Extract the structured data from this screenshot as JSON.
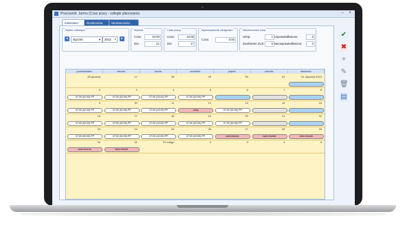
{
  "window": {
    "title": "Pracownik: Jarmu (Czas pracy - odległe planowania",
    "controls": {
      "minimize": "–",
      "close": "×"
    }
  },
  "tabs": [
    {
      "label": "Kalendarz",
      "active": true
    },
    {
      "label": "Rozliczenia",
      "active": false
    },
    {
      "label": "Nieobecności",
      "active": false
    }
  ],
  "filters": {
    "title": "Wybór miesiąca",
    "month": "styczeń",
    "year": "2013"
  },
  "summary": {
    "plan": {
      "title": "Wymiar",
      "czas_label": "Czas:",
      "czas_value": "42:00",
      "dni_label": "Dni:",
      "dni_value": "21"
    },
    "work": {
      "title": "Czas pracy",
      "czas_label": "Czas:",
      "czas_value": "34:00",
      "dni_label": "Dni:",
      "dni_value": "17"
    },
    "overtime": {
      "title": "Wykorzystanie nadgodzin",
      "czas_label": "Czas:",
      "czas_value": "0:00"
    },
    "absence": {
      "title": "Nieobecności (dni)",
      "urlop_label": "Urlop:",
      "urlop_value": "1",
      "zwolnienie_label": "Zwolnienie ZUS:",
      "zwolnienie_value": "5",
      "usprawiedliwione_label": "Usprawiedliwione:",
      "usprawiedliwione_value": "0",
      "nieusprawiedliwione_label": "Nieusprawiedliwione:",
      "nieusprawiedliwione_value": "0"
    }
  },
  "calendar": {
    "days": [
      "poniedziałek",
      "wtorek",
      "środa",
      "czwartek",
      "piątek",
      "sobota",
      "niedziela"
    ],
    "weeks": [
      {
        "nums": [
          "26 grudnia",
          "27",
          "28",
          "29",
          "30",
          "31",
          "01 stycznia 2013"
        ],
        "pills": [
          null,
          null,
          null,
          null,
          null,
          null,
          {
            "text": "",
            "kind": "blue"
          }
        ]
      },
      {
        "nums": [
          "2",
          "3",
          "4",
          "5",
          "6",
          "7",
          "8"
        ],
        "pills": [
          {
            "text": "07:00 (02:00) PP",
            "kind": "white"
          },
          {
            "text": "07:00 (02:00) PP",
            "kind": "white"
          },
          {
            "text": "07:00 (02:00) PP",
            "kind": "white"
          },
          {
            "text": "07:00 (02:00) PP",
            "kind": "white"
          },
          {
            "text": "",
            "kind": "blue"
          },
          {
            "text": "",
            "kind": "gray"
          },
          {
            "text": "",
            "kind": "blue"
          }
        ]
      },
      {
        "nums": [
          "9",
          "10",
          "11",
          "12",
          "13",
          "14",
          "15"
        ],
        "pills": [
          {
            "text": "07:00 (02:00) PP",
            "kind": "white"
          },
          {
            "text": "07:00 (02:00) PP",
            "kind": "white"
          },
          {
            "text": "07:00 (02:00) PP",
            "kind": "white"
          },
          {
            "text": "urlop",
            "kind": "pink"
          },
          {
            "text": "07:00 (02:00) PP",
            "kind": "white"
          },
          {
            "text": "",
            "kind": "gray"
          },
          {
            "text": "",
            "kind": "blue"
          }
        ]
      },
      {
        "nums": [
          "16",
          "17",
          "18",
          "19",
          "20",
          "21",
          "22"
        ],
        "pills": [
          {
            "text": "07:00 (02:00) PP",
            "kind": "white"
          },
          {
            "text": "07:00 (02:00) PP",
            "kind": "white"
          },
          {
            "text": "07:00 (02:00) PP",
            "kind": "white"
          },
          {
            "text": "07:00 (02:00) PP",
            "kind": "white"
          },
          {
            "text": "07:00 (02:00) PP",
            "kind": "white"
          },
          {
            "text": "",
            "kind": "gray"
          },
          {
            "text": "",
            "kind": "blue"
          }
        ]
      },
      {
        "nums": [
          "23",
          "24",
          "25",
          "26",
          "27",
          "28",
          "29"
        ],
        "pills": [
          {
            "text": "07:00 (02:00) PP",
            "kind": "white"
          },
          {
            "text": "07:00 (02:00) PP",
            "kind": "white"
          },
          {
            "text": "07:00 (02:00) PP",
            "kind": "white"
          },
          {
            "text": "07:00 (02:00) PP",
            "kind": "white"
          },
          {
            "text": "zwol.chorob.",
            "kind": "pink"
          },
          {
            "text": "zwol.chorob.",
            "kind": "pink"
          },
          {
            "text": "zwol.chorob.",
            "kind": "pink"
          }
        ]
      },
      {
        "nums": [
          "30",
          "31",
          "01 lutego",
          "2",
          "3",
          "4",
          "5"
        ],
        "pills": [
          {
            "text": "zwol.chorob.",
            "kind": "pink"
          },
          {
            "text": "zwol.chorob.",
            "kind": "pink"
          },
          null,
          null,
          null,
          null,
          null
        ]
      }
    ]
  },
  "side_buttons": [
    {
      "name": "save-icon",
      "glyph": "✔"
    },
    {
      "name": "cancel-icon",
      "glyph": "✖"
    },
    {
      "name": "add-icon",
      "glyph": "+"
    },
    {
      "name": "edit-icon",
      "glyph": "✎"
    },
    {
      "name": "delete-icon",
      "glyph": "🗑"
    },
    {
      "name": "schedule-icon",
      "glyph": "▤"
    }
  ],
  "colors": {
    "calendar_bg": "#fdf3c4",
    "pill_white": "#ffffff",
    "pill_blue": "#a9d3f3",
    "pill_gray": "#e3e3e3",
    "pill_pink": "#f3b7b7"
  }
}
